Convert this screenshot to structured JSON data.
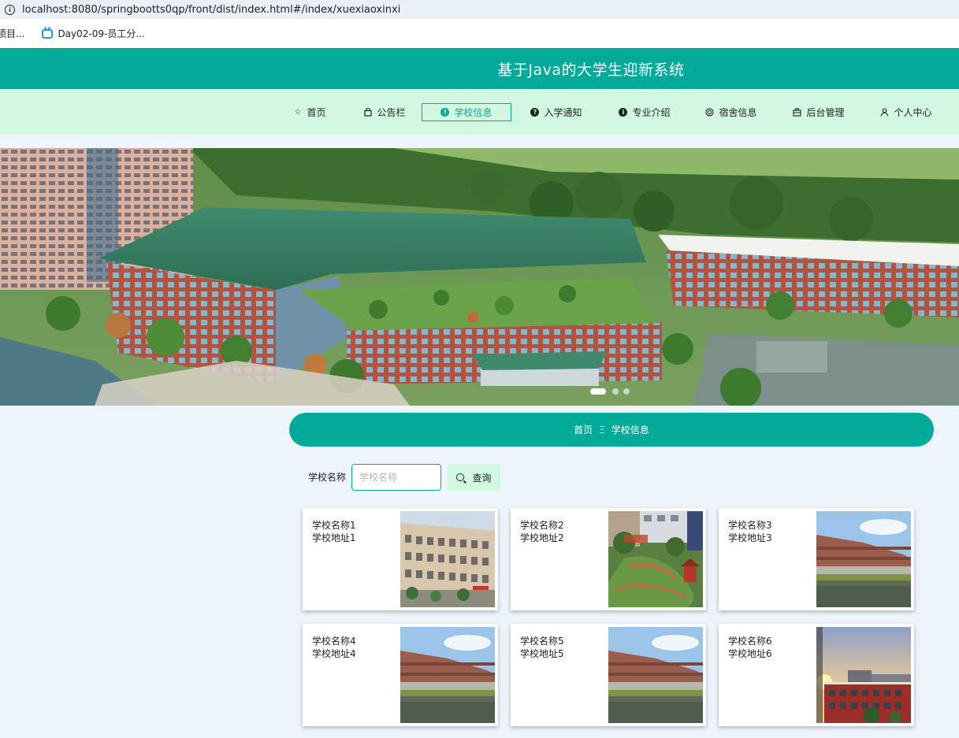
{
  "browser": {
    "url": "localhost:8080/springbootts0qp/front/dist/index.html#/index/xuexiaoxinxi",
    "bookmarks": [
      "项目...",
      "Day02-09-员工分..."
    ]
  },
  "site": {
    "title": "基于Java的大学生迎新系统"
  },
  "nav": {
    "items": [
      {
        "label": "首页",
        "icon": "star-icon"
      },
      {
        "label": "公告栏",
        "icon": "bag-icon"
      },
      {
        "label": "学校信息",
        "icon": "exclamation-circle-icon",
        "active": true
      },
      {
        "label": "入学通知",
        "icon": "question-circle-icon"
      },
      {
        "label": "专业介绍",
        "icon": "info-circle-icon"
      },
      {
        "label": "宿舍信息",
        "icon": "target-icon"
      },
      {
        "label": "后台管理",
        "icon": "briefcase-icon"
      },
      {
        "label": "个人中心",
        "icon": "user-icon"
      }
    ]
  },
  "breadcrumb": {
    "home": "首页",
    "separator": "Ξ",
    "current": "学校信息"
  },
  "search": {
    "label": "学校名称",
    "placeholder": "学校名称",
    "value": "",
    "button": "查询"
  },
  "cards": [
    {
      "name": "学校名称1",
      "address": "学校地址1",
      "image": "building-photo"
    },
    {
      "name": "学校名称2",
      "address": "学校地址2",
      "image": "garden-photo"
    },
    {
      "name": "学校名称3",
      "address": "学校地址3",
      "image": "campus-pond-photo"
    },
    {
      "name": "学校名称4",
      "address": "学校地址4",
      "image": "campus-pond-photo"
    },
    {
      "name": "学校名称5",
      "address": "学校地址5",
      "image": "campus-pond-photo"
    },
    {
      "name": "学校名称6",
      "address": "学校地址6",
      "image": "sunset-campus-photo"
    }
  ],
  "colors": {
    "primary": "#02ab99",
    "nav_bg": "#d3f8e1",
    "page_bg": "#eef4fb"
  }
}
